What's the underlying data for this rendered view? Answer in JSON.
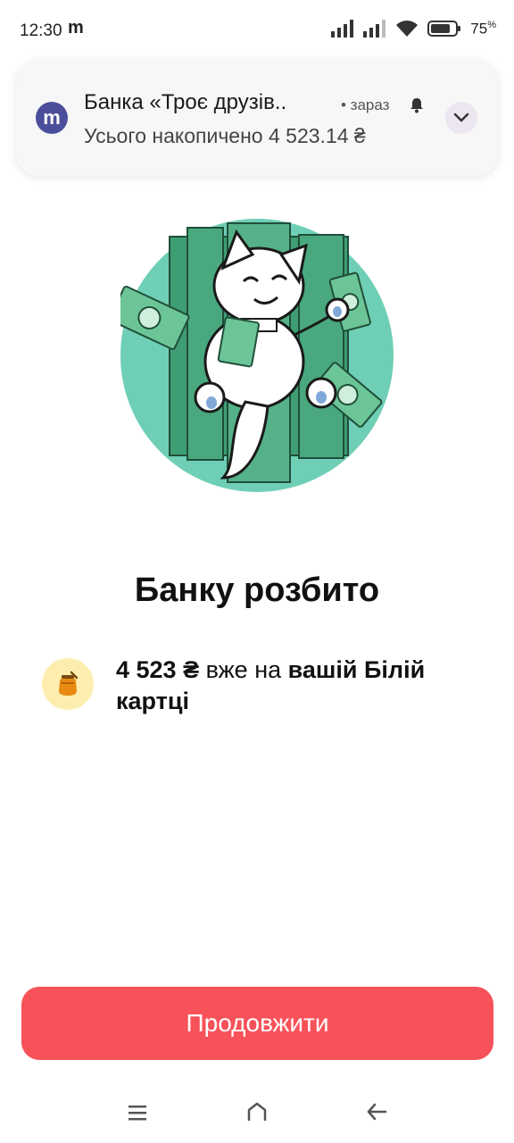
{
  "status_bar": {
    "time": "12:30",
    "notification_app_letter": "m",
    "battery_percent": "75",
    "battery_unit": "%"
  },
  "notification": {
    "avatar_letter": "m",
    "title": "Банка «Троє друзів..",
    "time_label": "• зараз",
    "body": "Усього накопичено 4 523.14 ₴",
    "avatar_color": "#4b4f9b"
  },
  "illustration": {
    "icon": "cat-with-money-illustration",
    "circle_color": "#6fcfb6"
  },
  "headline": "Банку розбито",
  "info": {
    "icon": "honey-jar-icon",
    "amount": "4 523 ₴",
    "middle_text": " вже на ",
    "destination": "вашій Білій картці"
  },
  "continue_button": {
    "label": "Продовжити",
    "color": "#f7525a"
  },
  "nav_bar": {
    "icons": [
      "menu-icon",
      "home-icon",
      "back-icon"
    ]
  }
}
